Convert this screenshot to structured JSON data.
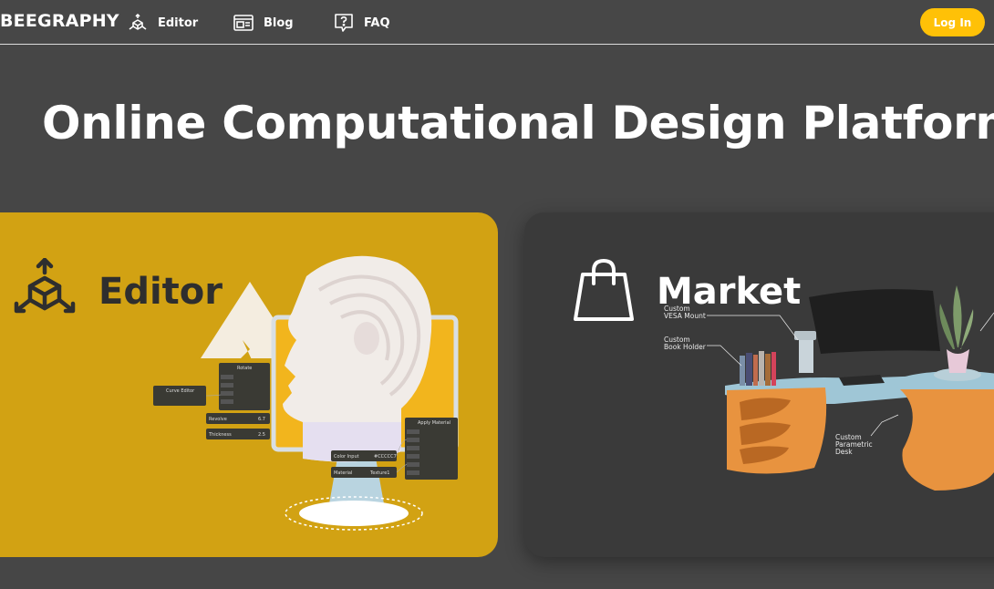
{
  "nav": {
    "logo": "BEEGRAPHY",
    "items": [
      {
        "label": "Editor",
        "icon": "cube-network-icon"
      },
      {
        "label": "Blog",
        "icon": "browser-window-icon"
      },
      {
        "label": "FAQ",
        "icon": "question-bubble-icon"
      }
    ],
    "login_label": "Log In"
  },
  "hero": {
    "title": "Online Computational Design Platform"
  },
  "cards": {
    "editor": {
      "title": "Editor",
      "icon": "cube-network-icon",
      "color": "#d2a213",
      "nodes": {
        "rotate": "Rotate",
        "curve_editor": "Curve Editor",
        "apply_material": "Apply Material",
        "revolve": "Revolve",
        "thickness": "Thickness",
        "color_input": "Color Input",
        "material": "Material",
        "material_value": "Texture1",
        "color_value": "#CCCCC7",
        "revolve_value": "6.7",
        "thickness_value": "2.5"
      }
    },
    "market": {
      "title": "Market",
      "icon": "shopping-bag-icon",
      "color": "#3a3a3a",
      "captions": {
        "vesa": [
          "Custom",
          "VESA Mount"
        ],
        "book": [
          "Custom",
          "Book Holder"
        ],
        "desk": [
          "Custom",
          "Parametric",
          "Desk"
        ]
      }
    }
  },
  "colors": {
    "background": "#464646",
    "accent": "#ffc107"
  }
}
